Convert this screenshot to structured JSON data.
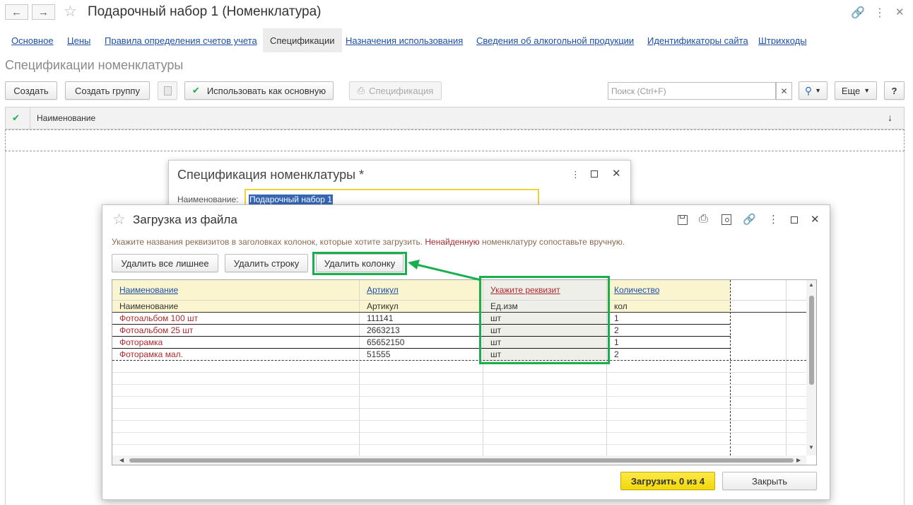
{
  "window": {
    "title": "Подарочный набор 1 (Номенклатура)"
  },
  "tabs": [
    {
      "label": "Основное"
    },
    {
      "label": "Цены"
    },
    {
      "label": "Правила определения счетов учета"
    },
    {
      "label": "Спецификации"
    },
    {
      "label": "Назначения использования"
    },
    {
      "label": "Сведения об алкогольной продукции"
    },
    {
      "label": "Идентификаторы сайта"
    },
    {
      "label": "Штрихкоды"
    }
  ],
  "section_title": "Спецификации номенклатуры",
  "toolbar": {
    "create": "Создать",
    "create_group": "Создать группу",
    "use_as_main": "Использовать как основную",
    "specification": "Спецификация",
    "search_placeholder": "Поиск (Ctrl+F)",
    "more": "Еще",
    "help": "?"
  },
  "grid": {
    "column_name": "Наименование",
    "sort_indicator": "↓"
  },
  "spec_dialog": {
    "title": "Спецификация номенклатуры *",
    "name_label": "Наименование:",
    "name_value": "Подарочный набор 1"
  },
  "load_dialog": {
    "title": "Загрузка из файла",
    "hint_part1": "Укажите названия реквизитов в заголовках колонок, которые хотите загрузить. ",
    "hint_red": "Ненайденную",
    "hint_part2": " номенклатуру сопоставьте вручную.",
    "buttons": {
      "delete_extra": "Удалить все лишнее",
      "delete_row": "Удалить строку",
      "delete_column": "Удалить колонку"
    },
    "columns": [
      {
        "header": "Наименование",
        "subheader": "Наименование"
      },
      {
        "header": "Артикул",
        "subheader": "Артикул"
      },
      {
        "header": "Укажите реквизит",
        "subheader": "Ед.изм"
      },
      {
        "header": "Количество",
        "subheader": "кол"
      }
    ],
    "rows": [
      {
        "name": "Фотоальбом 100 шт",
        "article": "111141",
        "unit": "шт",
        "qty": "1"
      },
      {
        "name": "Фотоальбом 25 шт",
        "article": "2663213",
        "unit": "шт",
        "qty": "2"
      },
      {
        "name": "Фоторамка",
        "article": "65652150",
        "unit": "шт",
        "qty": "1"
      },
      {
        "name": "Фоторамка мал.",
        "article": "51555",
        "unit": "шт",
        "qty": "2"
      }
    ],
    "load_button": "Загрузить 0 из 4",
    "close_button": "Закрыть"
  },
  "colors": {
    "accent_green": "#1aaf4e",
    "link_blue": "#1c4fa5",
    "error_red": "#b0282e",
    "primary_yellow": "#f2d80c"
  }
}
